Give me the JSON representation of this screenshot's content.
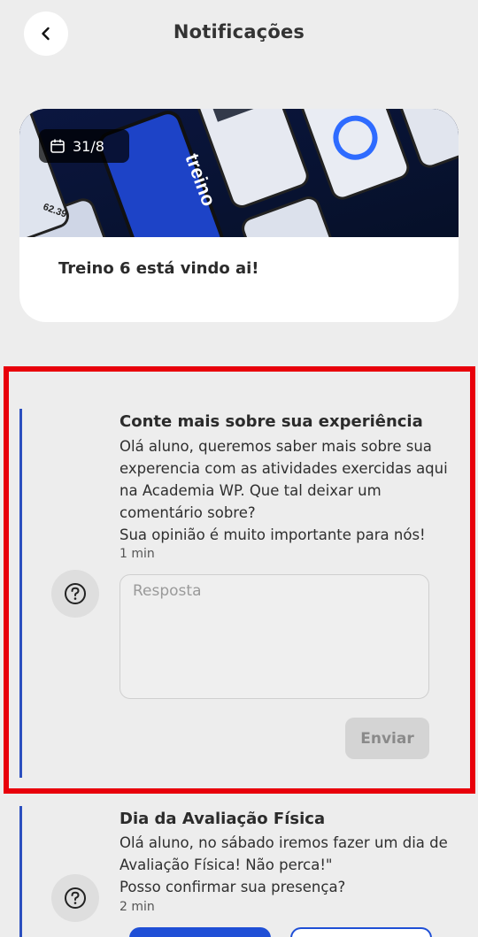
{
  "header": {
    "title": "Notificações",
    "back_icon": "chevron-left-icon"
  },
  "news": {
    "date": "31/8",
    "title": "Treino 6 está vindo ai!",
    "banner_brand": "treino",
    "banner_number": "62.39"
  },
  "notifications": [
    {
      "title": "Conte mais sobre sua experiência",
      "body": "Olá aluno, queremos saber mais sobre sua experencia com as atividades exercidas aqui na Academia WP. Que tal deixar um comentário sobre?\nSua opinião é muito importante para nós!",
      "time": "1 min",
      "answer_placeholder": "Resposta",
      "send_label": "Enviar"
    },
    {
      "title": "Dia da Avaliação Física",
      "body": "Olá aluno, no sábado iremos fazer um dia de Avaliação Física! Não perca!\"\nPosso confirmar sua presença?",
      "time": "2 min"
    }
  ],
  "colors": {
    "accent": "#1f4fd6",
    "highlight": "#e8000b",
    "background": "#ededed"
  }
}
